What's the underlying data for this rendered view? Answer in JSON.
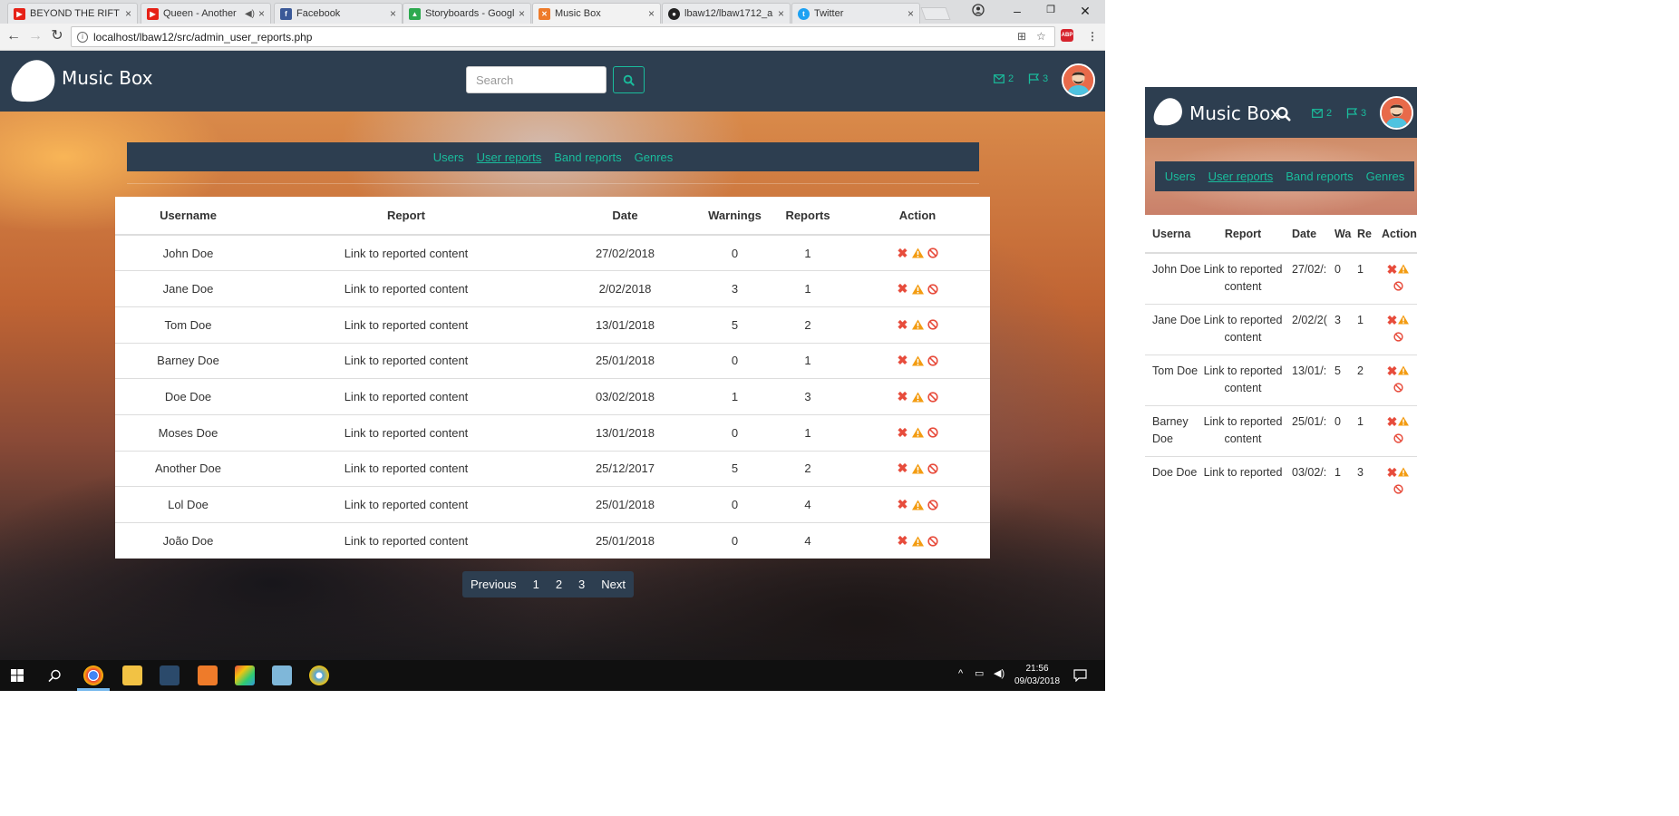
{
  "browser": {
    "tabs": [
      {
        "label": "BEYOND THE RIFT St",
        "favicon_color": "#e62117"
      },
      {
        "label": "Queen - Another",
        "favicon_color": "#e62117"
      },
      {
        "label": "Facebook",
        "favicon_color": "#3b5998"
      },
      {
        "label": "Storyboards - Googl",
        "favicon_color": "#2da94f"
      },
      {
        "label": "Music Box",
        "favicon_color": "#ee7b2a"
      },
      {
        "label": "lbaw12/lbaw1712_a",
        "favicon_color": "#222222"
      },
      {
        "label": "Twitter",
        "favicon_color": "#1da1f2"
      }
    ],
    "url_host": "localhost",
    "url_path": "/lbaw12/src/admin_user_reports.php",
    "extension_badge": "ABP"
  },
  "app": {
    "brand": "Music Box",
    "search_placeholder": "Search",
    "messages_count": "2",
    "flags_count": "3",
    "accent_color": "#1abc9c",
    "navbar_color": "#2d3e50"
  },
  "subnav": {
    "items": [
      "Users",
      "User reports",
      "Band reports",
      "Genres"
    ],
    "current": "User reports"
  },
  "table": {
    "headers": [
      "Username",
      "Report",
      "Date",
      "Warnings",
      "Reports",
      "Action"
    ],
    "rows": [
      {
        "username": "John Doe",
        "report": "Link to reported content",
        "date": "27/02/2018",
        "warnings": "0",
        "reports": "1"
      },
      {
        "username": "Jane Doe",
        "report": "Link to reported content",
        "date": "2/02/2018",
        "warnings": "3",
        "reports": "1"
      },
      {
        "username": "Tom Doe",
        "report": "Link to reported content",
        "date": "13/01/2018",
        "warnings": "5",
        "reports": "2"
      },
      {
        "username": "Barney Doe",
        "report": "Link to reported content",
        "date": "25/01/2018",
        "warnings": "0",
        "reports": "1"
      },
      {
        "username": "Doe Doe",
        "report": "Link to reported content",
        "date": "03/02/2018",
        "warnings": "1",
        "reports": "3"
      },
      {
        "username": "Moses Doe",
        "report": "Link to reported content",
        "date": "13/01/2018",
        "warnings": "0",
        "reports": "1"
      },
      {
        "username": "Another Doe",
        "report": "Link to reported content",
        "date": "25/12/2017",
        "warnings": "5",
        "reports": "2"
      },
      {
        "username": "Lol Doe",
        "report": "Link to reported content",
        "date": "25/01/2018",
        "warnings": "0",
        "reports": "4"
      },
      {
        "username": "João Doe",
        "report": "Link to reported content",
        "date": "25/01/2018",
        "warnings": "0",
        "reports": "4"
      }
    ],
    "actions": {
      "delete_icon": "times-icon",
      "warn_icon": "warning-icon",
      "ban_icon": "ban-icon",
      "delete_color": "#e74c3c",
      "warn_color": "#f39c12",
      "ban_color": "#e74c3c"
    }
  },
  "pagination": {
    "previous": "Previous",
    "pages": [
      "1",
      "2",
      "3"
    ],
    "next": "Next"
  },
  "taskbar": {
    "time": "21:56",
    "date": "09/03/2018"
  },
  "mobile": {
    "headers": [
      "Userna",
      "Report",
      "Date",
      "Wa",
      "Re",
      "Action"
    ],
    "rows": [
      {
        "username": "John Doe",
        "report": "Link to reported content",
        "date": "27/02/:",
        "warnings": "0",
        "reports": "1"
      },
      {
        "username": "Jane Doe",
        "report": "Link to reported content",
        "date": "2/02/2(",
        "warnings": "3",
        "reports": "1"
      },
      {
        "username": "Tom Doe",
        "report": "Link to reported content",
        "date": "13/01/:",
        "warnings": "5",
        "reports": "2"
      },
      {
        "username": "Barney Doe",
        "report": "Link to reported content",
        "date": "25/01/:",
        "warnings": "0",
        "reports": "1"
      },
      {
        "username": "Doe Doe",
        "report": "Link to reported",
        "date": "03/02/:",
        "warnings": "1",
        "reports": "3"
      }
    ]
  }
}
